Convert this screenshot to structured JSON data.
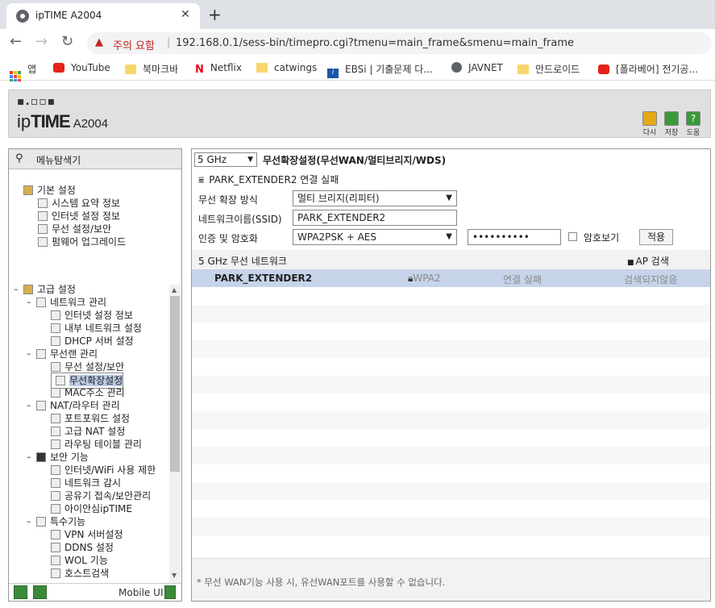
{
  "browser": {
    "tab_title": "ipTIME A2004",
    "security_warning": "주의 요함",
    "url": "192.168.0.1/sess-bin/timepro.cgi?tmenu=main_frame&smenu=main_frame",
    "bookmarks": [
      "앱",
      "YouTube",
      "북마크바",
      "Netflix",
      "catwings",
      "EBSi | 기출문제 다...",
      "JAVNET",
      "안드로이드",
      "[폴라베어] 전기공..."
    ]
  },
  "header": {
    "logo_dots": "▪.▫▫▪",
    "brand_ip": "ip",
    "brand_time": "TIME",
    "model": "A2004",
    "buttons": [
      "다시",
      "저장",
      "도움"
    ],
    "colors": {
      "back": "#e6a817",
      "save": "#3a9a3a",
      "help": "#3a9a3a"
    }
  },
  "left": {
    "title": "메뉴탐색기",
    "basic": {
      "label": "기본 설정",
      "items": [
        "시스템 요약 정보",
        "인터넷 설정 정보",
        "무선 설정/보안",
        "펌웨어 업그레이드"
      ]
    },
    "advanced": {
      "label": "고급 설정",
      "groups": [
        {
          "label": "네트워크 관리",
          "items": [
            "인터넷 설정 정보",
            "내부 네트워크 설정",
            "DHCP 서버 설정"
          ]
        },
        {
          "label": "무선랜 관리",
          "items": [
            "무선 설정/보안",
            "무선확장설정",
            "MAC주소 관리"
          ]
        },
        {
          "label": "NAT/라우터 관리",
          "items": [
            "포트포워드 설정",
            "고급 NAT 설정",
            "라우팅 테이블 관리"
          ]
        },
        {
          "label": "보안 기능",
          "items": [
            "인터넷/WiFi 사용 제한",
            "네트워크 감시",
            "공유기 접속/보안관리",
            "아이안심ipTIME"
          ]
        },
        {
          "label": "특수기능",
          "items": [
            "VPN 서버설정",
            "DDNS 설정",
            "WOL 기능",
            "호스트검색"
          ]
        }
      ]
    },
    "mobile_label": "Mobile UI"
  },
  "right": {
    "band": "5 GHz",
    "title": "무선확장설정(무선WAN/멀티브리지/WDS)",
    "status": "PARK_EXTENDER2 연결 실패",
    "fields": {
      "mode_label": "무선 확장 방식",
      "mode_value": "멀티 브리지(리피터)",
      "ssid_label": "네트워크이름(SSID)",
      "ssid_value": "PARK_EXTENDER2",
      "auth_label": "인증 및 암호화",
      "auth_value": "WPA2PSK + AES",
      "password_value": "••••••••••",
      "show_password_label": "암호보기",
      "apply_label": "적용"
    },
    "network_header": "5 GHz 무선 네트워크",
    "ap_search_label": "AP 검색",
    "networks": [
      {
        "ssid": "PARK_EXTENDER2",
        "security": "WPA2",
        "status": "연결 실패",
        "result": "검색되지않음"
      }
    ],
    "footnote": "* 무선 WAN기능 사용 시, 유선WAN포트를 사용할 수 없습니다."
  }
}
